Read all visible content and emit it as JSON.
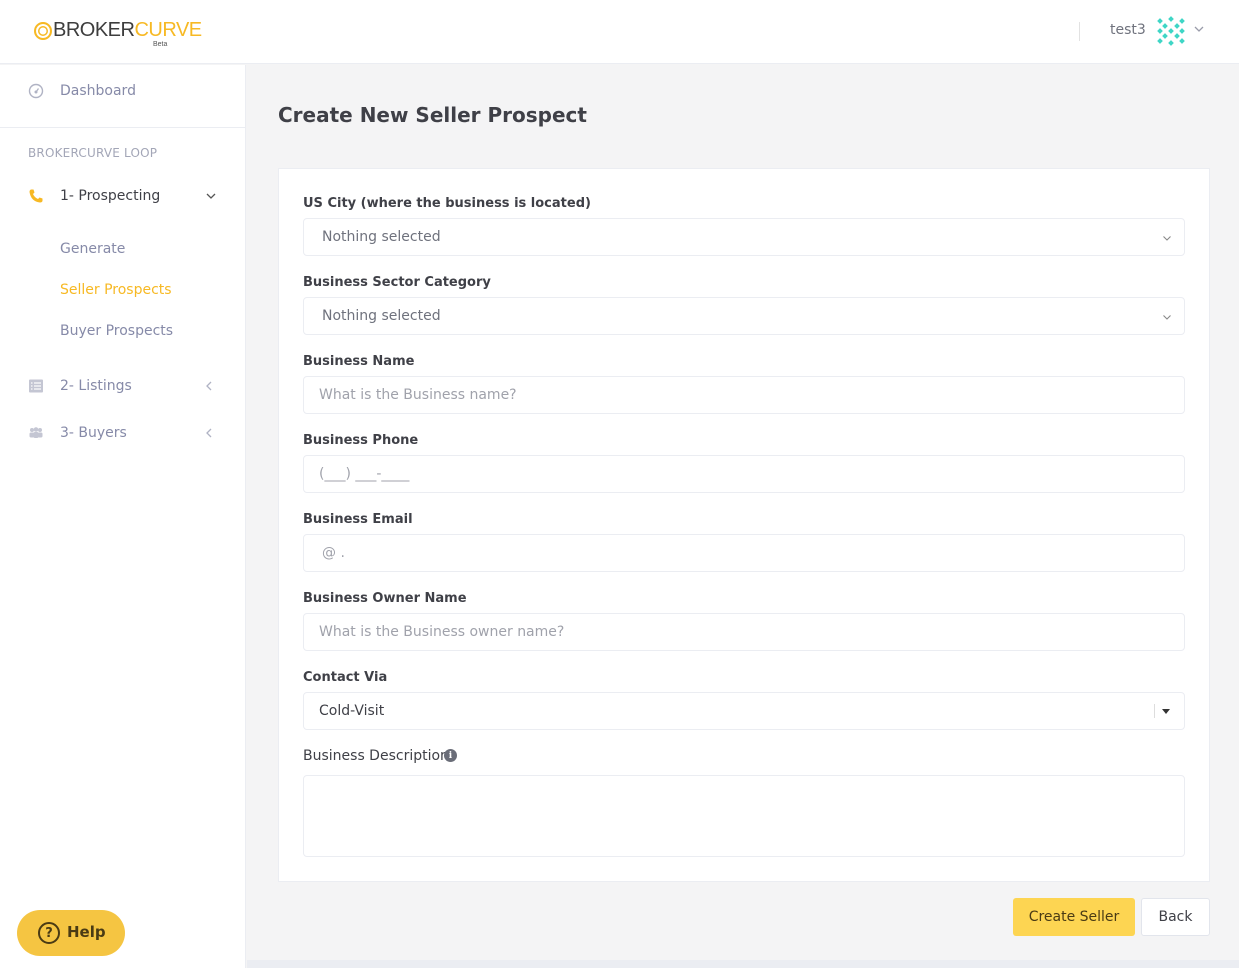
{
  "header": {
    "logo_brand_left": "BROKER",
    "logo_brand_right": "CURVE",
    "logo_badge": "Beta",
    "username": "test3"
  },
  "sidebar": {
    "dashboard_label": "Dashboard",
    "section_title": "BROKERCURVE LOOP",
    "prospecting_label": "1- Prospecting",
    "sub_items": [
      "Generate",
      "Seller Prospects",
      "Buyer Prospects"
    ],
    "listings_label": "2- Listings",
    "buyers_label": "3- Buyers",
    "help_label": "Help",
    "help_icon_glyph": "?",
    "accent_color": "#f7b924"
  },
  "main": {
    "page_title": "Create New Seller Prospect",
    "fields": {
      "city": {
        "label": "US City (where the business is located)",
        "value": "Nothing selected"
      },
      "sector": {
        "label": "Business Sector Category",
        "value": "Nothing selected"
      },
      "business_name": {
        "label": "Business Name",
        "placeholder": "What is the Business name?"
      },
      "phone": {
        "label": "Business Phone",
        "placeholder": "(___) ___-____"
      },
      "email": {
        "label": "Business Email",
        "placeholder": "@ ."
      },
      "owner_name": {
        "label": "Business Owner Name",
        "placeholder": "What is the Business owner name?"
      },
      "contact_via": {
        "label": "Contact Via",
        "value": "Cold-Visit"
      },
      "description": {
        "label": "Business Description",
        "info_glyph": "i"
      }
    },
    "buttons": {
      "create": "Create Seller",
      "back": "Back"
    }
  }
}
